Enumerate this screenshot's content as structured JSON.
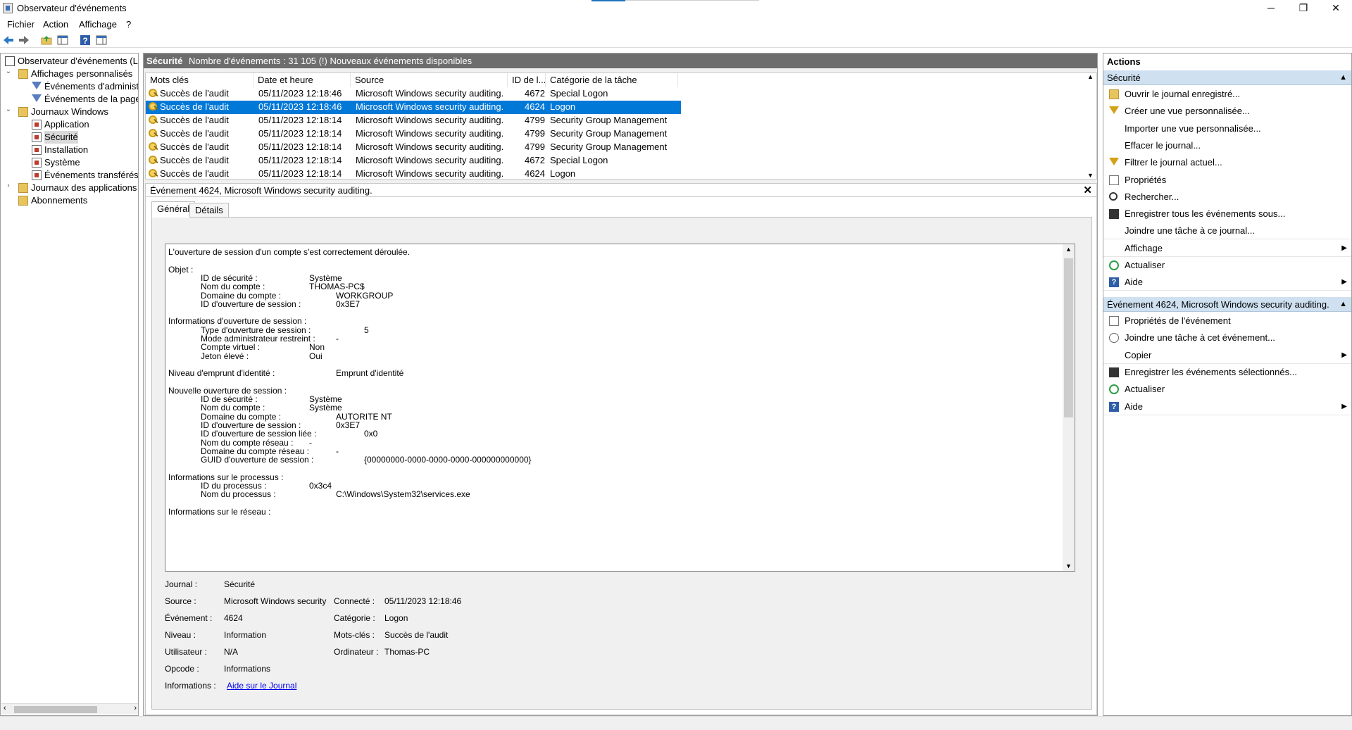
{
  "window": {
    "title": "Observateur d'événements",
    "min": "─",
    "restore": "❐",
    "close": "✕"
  },
  "menu": [
    "Fichier",
    "Action",
    "Affichage",
    "?"
  ],
  "toolbar": [
    "back-arrow-icon",
    "forward-arrow-icon",
    "folder-up-icon",
    "console-tree-icon",
    "help-icon",
    "properties-pane-icon"
  ],
  "tree": {
    "root": "Observateur d'événements (Local)",
    "custom_views": "Affichages personnalisés",
    "admin_events": "Événements d'administration",
    "page_events": "Événements de la page d'accueil",
    "windows_logs": "Journaux Windows",
    "application": "Application",
    "security": "Sécurité",
    "setup": "Installation",
    "system": "Système",
    "forwarded": "Événements transférés",
    "app_logs": "Journaux des applications et des services",
    "subscriptions": "Abonnements"
  },
  "log": {
    "name": "Sécurité",
    "count": "Nombre d'événements : 31 105 (!) Nouveaux événements disponibles"
  },
  "columns": [
    "Mots clés",
    "Date et heure",
    "Source",
    "ID de l...",
    "Catégorie de la tâche"
  ],
  "events": [
    {
      "keyword": "Succès de l'audit",
      "date": "05/11/2023 12:18:46",
      "source": "Microsoft Windows security auditing.",
      "id": "4672",
      "category": "Special Logon"
    },
    {
      "keyword": "Succès de l'audit",
      "date": "05/11/2023 12:18:46",
      "source": "Microsoft Windows security auditing.",
      "id": "4624",
      "category": "Logon"
    },
    {
      "keyword": "Succès de l'audit",
      "date": "05/11/2023 12:18:14",
      "source": "Microsoft Windows security auditing.",
      "id": "4799",
      "category": "Security Group Management"
    },
    {
      "keyword": "Succès de l'audit",
      "date": "05/11/2023 12:18:14",
      "source": "Microsoft Windows security auditing.",
      "id": "4799",
      "category": "Security Group Management"
    },
    {
      "keyword": "Succès de l'audit",
      "date": "05/11/2023 12:18:14",
      "source": "Microsoft Windows security auditing.",
      "id": "4799",
      "category": "Security Group Management"
    },
    {
      "keyword": "Succès de l'audit",
      "date": "05/11/2023 12:18:14",
      "source": "Microsoft Windows security auditing.",
      "id": "4672",
      "category": "Special Logon"
    },
    {
      "keyword": "Succès de l'audit",
      "date": "05/11/2023 12:18:14",
      "source": "Microsoft Windows security auditing.",
      "id": "4624",
      "category": "Logon"
    }
  ],
  "detail": {
    "title": "Événement 4624, Microsoft Windows security auditing.",
    "close": "✕",
    "tabs": [
      "Général",
      "Détails"
    ],
    "description": [
      {
        "indent": 0,
        "label": "L'ouverture de session d'un compte s'est correctement déroulée.",
        "value": ""
      },
      {
        "indent": 0,
        "label": "",
        "value": ""
      },
      {
        "indent": 0,
        "label": "Objet :",
        "value": ""
      },
      {
        "indent": 1,
        "label": "ID de sécurité :",
        "value": "Système",
        "col": 1
      },
      {
        "indent": 1,
        "label": "Nom du compte :",
        "value": "THOMAS-PC$",
        "col": 1
      },
      {
        "indent": 1,
        "label": "Domaine du compte :",
        "value": "WORKGROUP",
        "col": 2
      },
      {
        "indent": 1,
        "label": "ID d'ouverture de session :",
        "value": "0x3E7",
        "col": 2
      },
      {
        "indent": 0,
        "label": "",
        "value": ""
      },
      {
        "indent": 0,
        "label": "Informations d'ouverture de session :",
        "value": ""
      },
      {
        "indent": 1,
        "label": "Type d'ouverture de session :",
        "value": "5",
        "col": 3
      },
      {
        "indent": 1,
        "label": "Mode administrateur restreint :",
        "value": "-",
        "col": 2
      },
      {
        "indent": 1,
        "label": "Compte virtuel :",
        "value": "Non",
        "col": 1
      },
      {
        "indent": 1,
        "label": "Jeton élevé :",
        "value": "Oui",
        "col": 1
      },
      {
        "indent": 0,
        "label": "",
        "value": ""
      },
      {
        "indent": 0,
        "label": "Niveau d'emprunt d'identité :",
        "value": "Emprunt d'identité",
        "col": 2
      },
      {
        "indent": 0,
        "label": "",
        "value": ""
      },
      {
        "indent": 0,
        "label": "Nouvelle ouverture de session :",
        "value": ""
      },
      {
        "indent": 1,
        "label": "ID de sécurité :",
        "value": "Système",
        "col": 1
      },
      {
        "indent": 1,
        "label": "Nom du compte :",
        "value": "Système",
        "col": 1
      },
      {
        "indent": 1,
        "label": "Domaine du compte :",
        "value": "AUTORITE NT",
        "col": 2
      },
      {
        "indent": 1,
        "label": "ID d'ouverture de session :",
        "value": "0x3E7",
        "col": 2
      },
      {
        "indent": 1,
        "label": "ID d'ouverture de session liée :",
        "value": "0x0",
        "col": 3
      },
      {
        "indent": 1,
        "label": "Nom du compte réseau :",
        "value": "-",
        "col": 0
      },
      {
        "indent": 1,
        "label": "Domaine du compte réseau :",
        "value": "-",
        "col": 2
      },
      {
        "indent": 1,
        "label": "GUID d'ouverture de session :",
        "value": "{00000000-0000-0000-0000-000000000000}",
        "col": 3
      },
      {
        "indent": 0,
        "label": "",
        "value": ""
      },
      {
        "indent": 0,
        "label": "Informations sur le processus :",
        "value": ""
      },
      {
        "indent": 1,
        "label": "ID du processus :",
        "value": "0x3c4",
        "col": 1
      },
      {
        "indent": 1,
        "label": "Nom du processus :",
        "value": "C:\\Windows\\System32\\services.exe",
        "col": 2
      },
      {
        "indent": 0,
        "label": "",
        "value": ""
      },
      {
        "indent": 0,
        "label": "Informations sur le réseau :",
        "value": ""
      }
    ],
    "props": {
      "journal_label": "Journal :",
      "journal": "Sécurité",
      "source_label": "Source :",
      "source": "Microsoft Windows security",
      "connected_label": "Connecté :",
      "connected": "05/11/2023 12:18:46",
      "event_label": "Événement :",
      "event": "4624",
      "category_label": "Catégorie :",
      "category": "Logon",
      "level_label": "Niveau :",
      "level": "Information",
      "keywords_label": "Mots-clés :",
      "keywords": "Succès de l'audit",
      "user_label": "Utilisateur :",
      "user": "N/A",
      "computer_label": "Ordinateur :",
      "computer": "Thomas-PC",
      "opcode_label": "Opcode :",
      "opcode": "Informations",
      "info_label": "Informations :",
      "info_link": "Aide sur le Journal"
    }
  },
  "actions": {
    "header": "Actions",
    "section1": "Sécurité",
    "section1_items": [
      {
        "label": "Ouvrir le journal enregistré...",
        "icon": "open-folder-icon"
      },
      {
        "label": "Créer une vue personnalisée...",
        "icon": "filter-icon"
      },
      {
        "label": "Importer une vue personnalisée...",
        "icon": ""
      },
      {
        "label": "Effacer le journal...",
        "icon": ""
      },
      {
        "label": "Filtrer le journal actuel...",
        "icon": "filter-icon"
      },
      {
        "label": "Propriétés",
        "icon": "properties-icon"
      },
      {
        "label": "Rechercher...",
        "icon": "binoculars-icon"
      },
      {
        "label": "Enregistrer tous les événements sous...",
        "icon": "save-icon"
      },
      {
        "label": "Joindre une tâche à ce journal...",
        "icon": ""
      },
      {
        "label": "Affichage",
        "icon": "",
        "submenu": true
      },
      {
        "label": "Actualiser",
        "icon": "refresh-icon"
      },
      {
        "label": "Aide",
        "icon": "help-icon",
        "submenu": true
      }
    ],
    "section2": "Événement 4624, Microsoft Windows security auditing.",
    "section2_items": [
      {
        "label": "Propriétés de l'événement",
        "icon": "properties-icon"
      },
      {
        "label": "Joindre une tâche à cet événement...",
        "icon": "task-icon"
      },
      {
        "label": "Copier",
        "icon": "",
        "submenu": true
      },
      {
        "label": "Enregistrer les événements sélectionnés...",
        "icon": "save-icon"
      },
      {
        "label": "Actualiser",
        "icon": "refresh-icon"
      },
      {
        "label": "Aide",
        "icon": "help-icon",
        "submenu": true
      }
    ]
  },
  "colors": {
    "selection": "#0078d7",
    "section_header": "#cfe0f0",
    "log_header": "#6d6d6d"
  }
}
